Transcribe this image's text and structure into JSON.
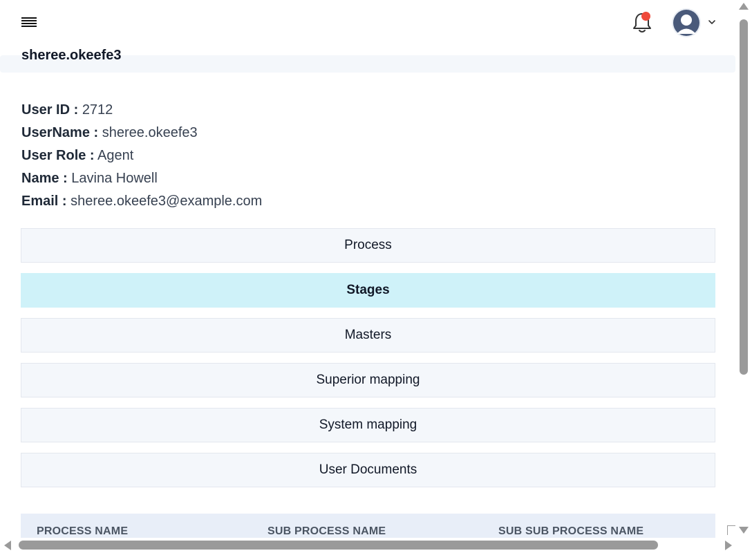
{
  "header": {
    "menu_icon": "hamburger-menu-icon",
    "notification_icon": "bell-icon",
    "notification_dot_color": "#ef4a3b",
    "avatar_icon": "user-avatar-icon",
    "dropdown_icon": "chevron-down-icon"
  },
  "page": {
    "title": "sheree.okeefe3"
  },
  "user_info": [
    {
      "label": "User ID :",
      "value": "2712"
    },
    {
      "label": "UserName :",
      "value": "sheree.okeefe3"
    },
    {
      "label": "User Role :",
      "value": "Agent"
    },
    {
      "label": "Name :",
      "value": "Lavina Howell"
    },
    {
      "label": "Email :",
      "value": "sheree.okeefe3@example.com"
    }
  ],
  "sections": [
    {
      "label": "Process",
      "active": false
    },
    {
      "label": "Stages",
      "active": true
    },
    {
      "label": "Masters",
      "active": false
    },
    {
      "label": "Superior mapping",
      "active": false
    },
    {
      "label": "System mapping",
      "active": false
    },
    {
      "label": "User Documents",
      "active": false
    }
  ],
  "table": {
    "columns": [
      "PROCESS NAME",
      "SUB PROCESS NAME",
      "SUB SUB PROCESS NAME"
    ]
  },
  "colors": {
    "active_section_bg": "#cff2f9",
    "section_bg": "#f4f7fb",
    "table_header_bg": "#e8eef8"
  }
}
